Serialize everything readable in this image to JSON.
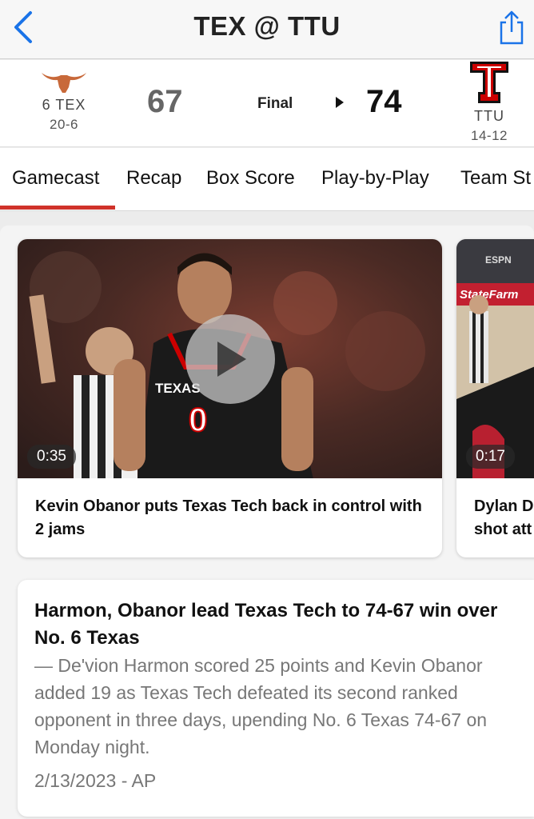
{
  "nav": {
    "title": "TEX @ TTU",
    "back_icon": "chevron-left-icon",
    "share_icon": "share-icon",
    "accent_color": "#1a73e8"
  },
  "game": {
    "away": {
      "rank_name": "6 TEX",
      "record": "20-6",
      "score": "67",
      "logo": "longhorn-logo",
      "color": "#c8693a"
    },
    "home": {
      "name": "TTU",
      "record": "14-12",
      "score": "74",
      "logo": "double-t-logo",
      "color": "#cc0000"
    },
    "status": "Final",
    "winner_indicator_icon": "winner-arrow-icon"
  },
  "tabs": [
    {
      "label": "Gamecast",
      "active": true
    },
    {
      "label": "Recap"
    },
    {
      "label": "Box Score"
    },
    {
      "label": "Play-by-Play"
    },
    {
      "label": "Team St"
    }
  ],
  "tab_active_color": "#d0322a",
  "videos": [
    {
      "duration": "0:35",
      "caption": "Kevin Obanor puts Texas Tech back in control with 2 jams",
      "jersey_text": "TEXAS",
      "jersey_number": "0"
    },
    {
      "duration": "0:17",
      "caption": "Dylan D shot att",
      "banner_text": "StateFarm",
      "network_text": "ESPN"
    }
  ],
  "article": {
    "headline": "Harmon, Obanor lead Texas Tech to 74-67 win over No. 6 Texas",
    "summary": "— De'vion Harmon scored 25 points and Kevin Obanor added 19 as Texas Tech defeated its second ranked opponent in three days, upending No. 6 Texas 74-67 on Monday night.",
    "meta": "2/13/2023 - AP"
  }
}
